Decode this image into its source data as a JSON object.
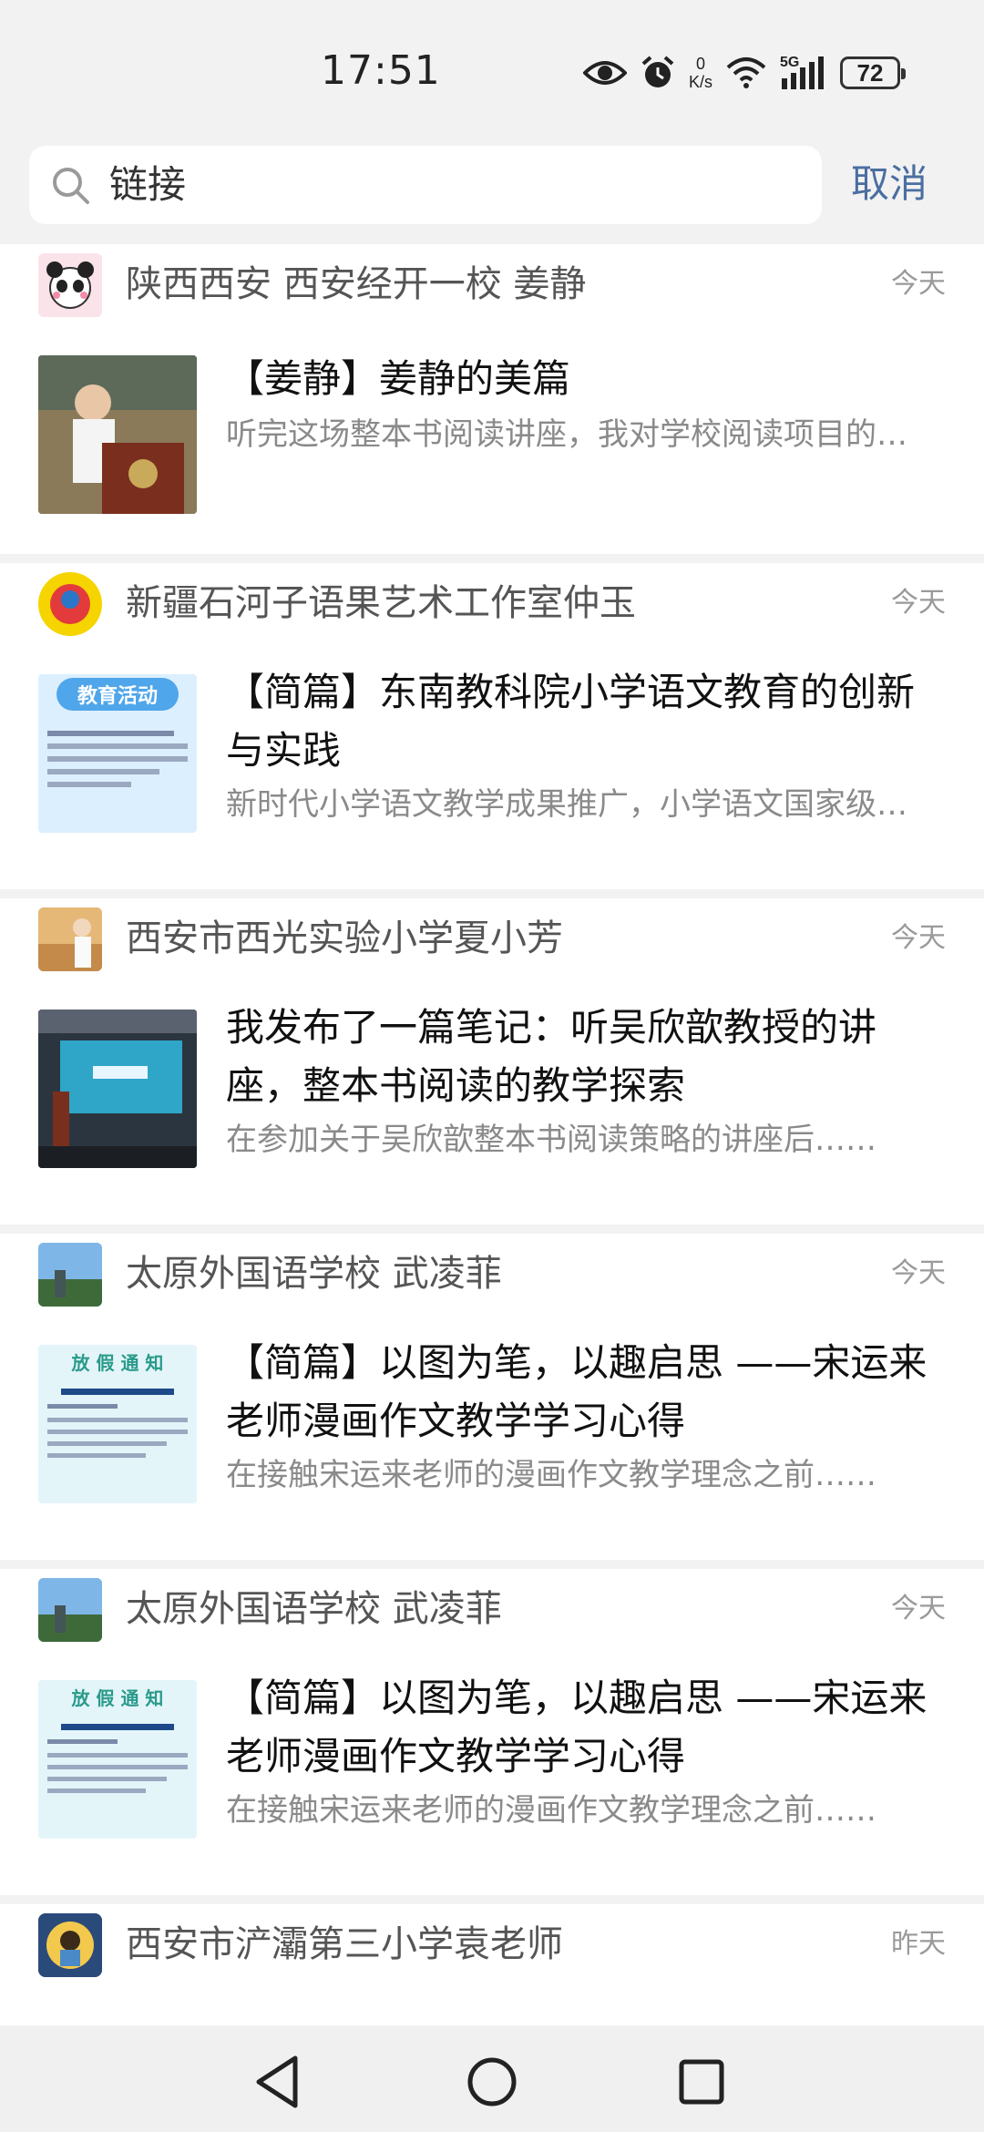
{
  "status_bar": {
    "time": "17:51",
    "net_speed_value": "0",
    "net_speed_unit": "K/s",
    "network": "5G",
    "battery": "72",
    "icons": [
      "eye-icon",
      "alarm-icon",
      "wifi-icon",
      "signal-icon",
      "battery-icon"
    ]
  },
  "search": {
    "query": "链接",
    "cancel_label": "取消"
  },
  "results": [
    {
      "author": "陕西西安  西安经开一校  姜静",
      "date": "今天",
      "title": "【姜静】姜静的美篇",
      "summary": "听完这场整本书阅读讲座，我对学校阅读项目的认识更加深刻……",
      "thumb": "speaker-at-podium"
    },
    {
      "author": "新疆石河子语果艺术工作室仲玉",
      "date": "今天",
      "title": "【简篇】东南教科院小学语文教育的创新与实践",
      "summary": "新时代小学语文教学成果推广，小学语文国家级课程……",
      "thumb": "education-activity-poster",
      "thumb_text": "教育活动"
    },
    {
      "author": "西安市西光实验小学夏小芳",
      "date": "今天",
      "title": "我发布了一篇笔记：听吴欣歆教授的讲座，整本书阅读的教学探索",
      "summary": "在参加关于吴欣歆整本书阅读策略的讲座后……",
      "thumb": "lecture-hall-screen"
    },
    {
      "author": "太原外国语学校 武凌菲",
      "date": "今天",
      "title": "【简篇】以图为笔，以趣启思 ——宋运来老师漫画作文教学学习心得",
      "summary": "在接触宋运来老师的漫画作文教学理念之前……",
      "thumb": "holiday-notice",
      "thumb_text": "放 假 通 知"
    },
    {
      "author": "太原外国语学校 武凌菲",
      "date": "今天",
      "title": "【简篇】以图为笔，以趣启思 ——宋运来老师漫画作文教学学习心得",
      "summary": "在接触宋运来老师的漫画作文教学理念之前……",
      "thumb": "holiday-notice",
      "thumb_text": "放 假 通 知"
    },
    {
      "author": "西安市浐灞第三小学袁老师",
      "date": "昨天"
    }
  ],
  "nav": {
    "back": "back-icon",
    "home": "home-icon",
    "recents": "recents-icon"
  },
  "colors": {
    "accent": "#4a6ea0",
    "background": "#f2f2f2",
    "card": "#ffffff"
  }
}
